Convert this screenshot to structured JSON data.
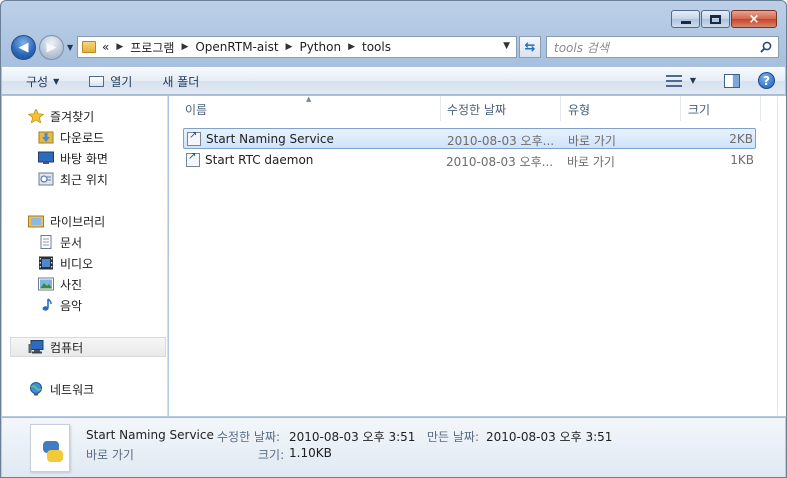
{
  "window": {
    "caption_buttons": {
      "minimize": "minimize",
      "maximize": "maximize",
      "close": "×"
    }
  },
  "address_bar": {
    "overflow": "«",
    "crumbs": [
      "프로그램",
      "OpenRTM-aist",
      "Python",
      "tools"
    ]
  },
  "search": {
    "placeholder": "tools 검색"
  },
  "toolbar": {
    "organize_label": "구성",
    "open_label": "열기",
    "new_folder_label": "새 폴더"
  },
  "nav_pane": {
    "favorites": {
      "label": "즐겨찾기",
      "items": [
        "다운로드",
        "바탕 화면",
        "최근 위치"
      ]
    },
    "libraries": {
      "label": "라이브러리",
      "items": [
        "문서",
        "비디오",
        "사진",
        "음악"
      ]
    },
    "computer": {
      "label": "컴퓨터"
    },
    "network": {
      "label": "네트워크"
    }
  },
  "file_list": {
    "columns": [
      "이름",
      "수정한 날짜",
      "유형",
      "크기"
    ],
    "rows": [
      {
        "name": "Start Naming Service",
        "modified": "2010-08-03 오후...",
        "type": "바로 가기",
        "size": "2KB",
        "selected": true
      },
      {
        "name": "Start RTC daemon",
        "modified": "2010-08-03 오후...",
        "type": "바로 가기",
        "size": "1KB",
        "selected": false
      }
    ]
  },
  "details_pane": {
    "name": "Start Naming Service",
    "type": "바로 가기",
    "modified_label": "수정한 날짜:",
    "modified_value": "2010-08-03 오후 3:51",
    "created_label": "만든 날짜:",
    "created_value": "2010-08-03 오후 3:51",
    "size_label": "크기:",
    "size_value": "1.10KB"
  },
  "colors": {
    "accent": "#2a66b8",
    "selection": "#cfe3fb"
  }
}
